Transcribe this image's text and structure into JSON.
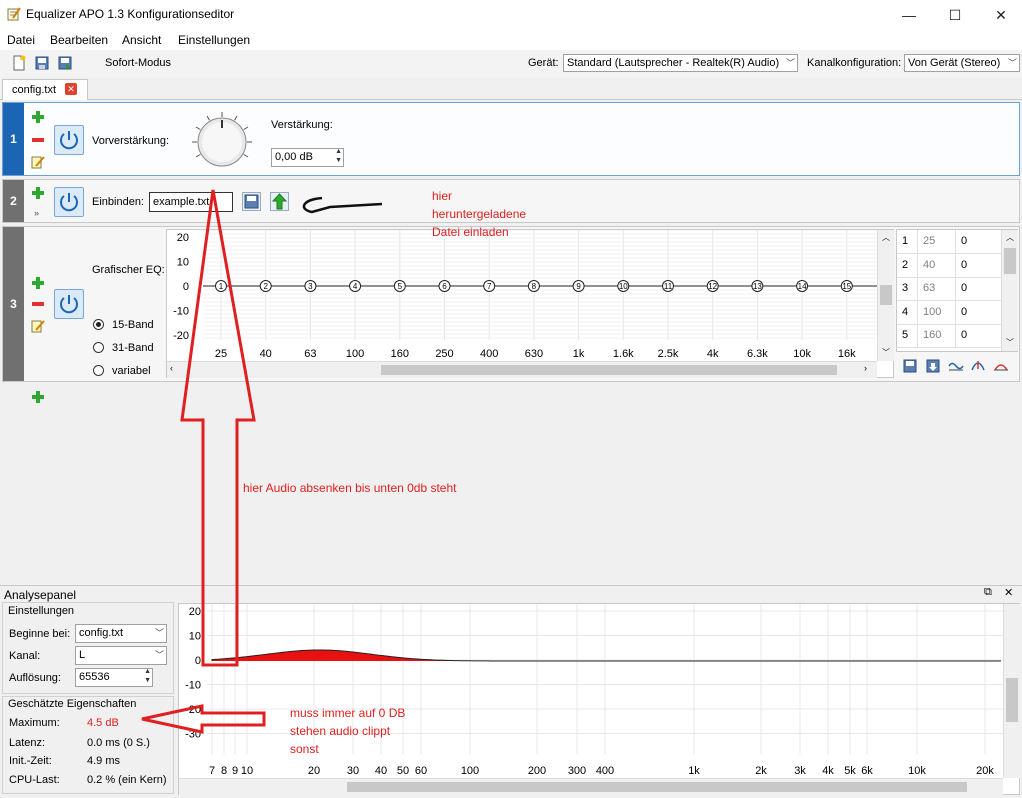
{
  "window": {
    "title": "Equalizer APO 1.3 Konfigurationseditor",
    "minimize": "—",
    "maximize": "☐",
    "close": "✕"
  },
  "menu": [
    "Datei",
    "Bearbeiten",
    "Ansicht",
    "Einstellungen"
  ],
  "toolbar": {
    "instant_mode_label": "Sofort-Modus",
    "device_label": "Gerät:",
    "device_value": "Standard (Lautsprecher - Realtek(R) Audio)",
    "channel_label": "Kanalkonfiguration:",
    "channel_value": "Von Gerät (Stereo)"
  },
  "tab": {
    "label": "config.txt"
  },
  "filters": {
    "f1": {
      "num": "1",
      "preamp_label": "Vorverstärkung:",
      "gain_label": "Verstärkung:",
      "gain_value": "0,00 dB"
    },
    "f2": {
      "num": "2",
      "include_label": "Einbinden:",
      "include_value": "example.txt"
    },
    "f3": {
      "num": "3",
      "label": "Grafischer EQ:",
      "modes": [
        "15-Band",
        "31-Band",
        "variabel"
      ],
      "selected_mode": "15-Band",
      "y_ticks": [
        "20",
        "10",
        "0",
        "-10",
        "-20"
      ],
      "freq_labels": [
        "25",
        "40",
        "63",
        "100",
        "160",
        "250",
        "400",
        "630",
        "1k",
        "1.6k",
        "2.5k",
        "4k",
        "6.3k",
        "10k",
        "16k"
      ],
      "nodes": [
        "1",
        "2",
        "3",
        "4",
        "5",
        "6",
        "7",
        "8",
        "9",
        "10",
        "11",
        "12",
        "13",
        "14",
        "15"
      ],
      "table": [
        {
          "idx": "1",
          "freq": "25",
          "gain": "0"
        },
        {
          "idx": "2",
          "freq": "40",
          "gain": "0"
        },
        {
          "idx": "3",
          "freq": "63",
          "gain": "0"
        },
        {
          "idx": "4",
          "freq": "100",
          "gain": "0"
        },
        {
          "idx": "5",
          "freq": "160",
          "gain": "0"
        }
      ]
    }
  },
  "annotations": {
    "load_file": [
      "hier",
      "heruntergeladene",
      "Datei einladen"
    ],
    "lower_audio": "hier Audio absenken bis unten 0db steht",
    "zero_db": [
      "muss immer auf 0 DB",
      "stehen audio clippt",
      "sonst"
    ]
  },
  "analysis": {
    "title": "Analysepanel",
    "settings_header": "Einstellungen",
    "start_label": "Beginne bei:",
    "start_value": "config.txt",
    "channel_label": "Kanal:",
    "channel_value": "L",
    "resolution_label": "Auflösung:",
    "resolution_value": "65536",
    "estimated_header": "Geschätzte Eigenschaften",
    "max_label": "Maximum:",
    "max_value": "4.5 dB",
    "latency_label": "Latenz:",
    "latency_value": "0.0 ms (0 S.)",
    "init_label": "Init.-Zeit:",
    "init_value": "4.9 ms",
    "cpu_label": "CPU-Last:",
    "cpu_value": "0.2 % (ein Kern)",
    "y_ticks": [
      "20",
      "10",
      "0",
      "-10",
      "-20",
      "-30"
    ],
    "x_ticks": [
      "7",
      "8",
      "9",
      "10",
      "20",
      "30",
      "40",
      "50",
      "60",
      "100",
      "200",
      "300",
      "400",
      "1k",
      "2k",
      "3k",
      "4k",
      "5k",
      "6k",
      "10k",
      "20k"
    ]
  },
  "colors": {
    "accent": "#1c64b4",
    "annotation": "#e02020",
    "panel_bar": "#707070"
  }
}
